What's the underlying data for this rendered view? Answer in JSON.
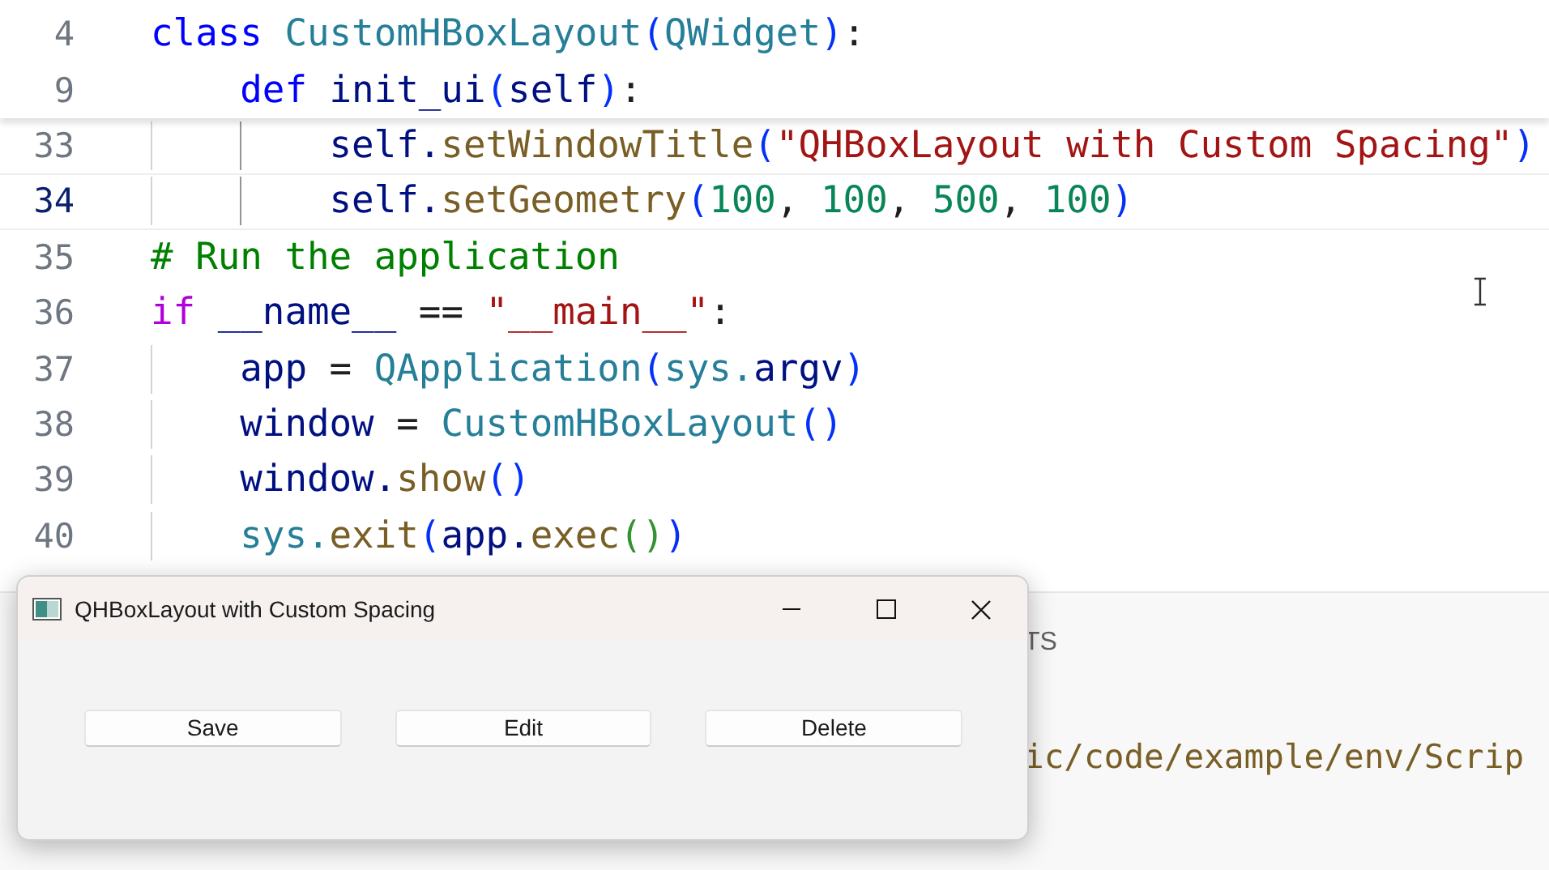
{
  "editor": {
    "sticky_lines": [
      {
        "number": "4",
        "tokens": [
          {
            "kind": "keyword",
            "text": "class "
          },
          {
            "kind": "type",
            "text": "CustomHBoxLayout"
          },
          {
            "kind": "bracket",
            "text": "("
          },
          {
            "kind": "type",
            "text": "QWidget"
          },
          {
            "kind": "bracket",
            "text": ")"
          },
          {
            "kind": "plain",
            "text": ":"
          }
        ]
      },
      {
        "number": "9",
        "tokens": [
          {
            "kind": "keyword",
            "text": "    def "
          },
          {
            "kind": "variable",
            "text": "init_ui"
          },
          {
            "kind": "bracket",
            "text": "("
          },
          {
            "kind": "variable",
            "text": "self"
          },
          {
            "kind": "bracket",
            "text": ")"
          },
          {
            "kind": "plain",
            "text": ":"
          }
        ]
      }
    ],
    "lines": [
      {
        "number": "33",
        "active": false,
        "tokens": [
          {
            "kind": "variable",
            "text": "        self."
          },
          {
            "kind": "function",
            "text": "setWindowTitle"
          },
          {
            "kind": "bracket",
            "text": "("
          },
          {
            "kind": "string",
            "text": "\"QHBoxLayout with Custom Spacing\""
          },
          {
            "kind": "bracket",
            "text": ")"
          }
        ]
      },
      {
        "number": "34",
        "active": true,
        "tokens": [
          {
            "kind": "variable",
            "text": "        self."
          },
          {
            "kind": "function",
            "text": "setGeometry"
          },
          {
            "kind": "bracket",
            "text": "("
          },
          {
            "kind": "number",
            "text": "100"
          },
          {
            "kind": "plain",
            "text": ", "
          },
          {
            "kind": "number",
            "text": "100"
          },
          {
            "kind": "plain",
            "text": ", "
          },
          {
            "kind": "number",
            "text": "500"
          },
          {
            "kind": "plain",
            "text": ", "
          },
          {
            "kind": "number",
            "text": "100"
          },
          {
            "kind": "bracket",
            "text": ")"
          }
        ]
      },
      {
        "number": "35",
        "active": false,
        "tokens": [
          {
            "kind": "comment",
            "text": "# Run the application"
          }
        ]
      },
      {
        "number": "36",
        "active": false,
        "tokens": [
          {
            "kind": "control",
            "text": "if "
          },
          {
            "kind": "variable",
            "text": "__name__"
          },
          {
            "kind": "plain",
            "text": " == "
          },
          {
            "kind": "string",
            "text": "\"__main__\""
          },
          {
            "kind": "plain",
            "text": ":"
          }
        ]
      },
      {
        "number": "37",
        "active": false,
        "tokens": [
          {
            "kind": "variable",
            "text": "    app"
          },
          {
            "kind": "plain",
            "text": " = "
          },
          {
            "kind": "type",
            "text": "QApplication"
          },
          {
            "kind": "bracket",
            "text": "("
          },
          {
            "kind": "type",
            "text": "sys."
          },
          {
            "kind": "variable",
            "text": "argv"
          },
          {
            "kind": "bracket",
            "text": ")"
          }
        ]
      },
      {
        "number": "38",
        "active": false,
        "tokens": [
          {
            "kind": "variable",
            "text": "    window"
          },
          {
            "kind": "plain",
            "text": " = "
          },
          {
            "kind": "type",
            "text": "CustomHBoxLayout"
          },
          {
            "kind": "bracket",
            "text": "()"
          }
        ]
      },
      {
        "number": "39",
        "active": false,
        "tokens": [
          {
            "kind": "variable",
            "text": "    window."
          },
          {
            "kind": "function",
            "text": "show"
          },
          {
            "kind": "bracket",
            "text": "()"
          }
        ]
      },
      {
        "number": "40",
        "active": false,
        "tokens": [
          {
            "kind": "type",
            "text": "    sys."
          },
          {
            "kind": "function",
            "text": "exit"
          },
          {
            "kind": "bracket",
            "text": "("
          },
          {
            "kind": "variable",
            "text": "app."
          },
          {
            "kind": "function",
            "text": "exec"
          },
          {
            "kind": "bracket2",
            "text": "()"
          },
          {
            "kind": "bracket",
            "text": ")"
          }
        ]
      }
    ]
  },
  "panel": {
    "tab_label": "TS",
    "terminal_text": "ic/code/example/env/Scrip"
  },
  "dialog": {
    "title": "QHBoxLayout with Custom Spacing",
    "buttons": [
      "Save",
      "Edit",
      "Delete"
    ]
  }
}
